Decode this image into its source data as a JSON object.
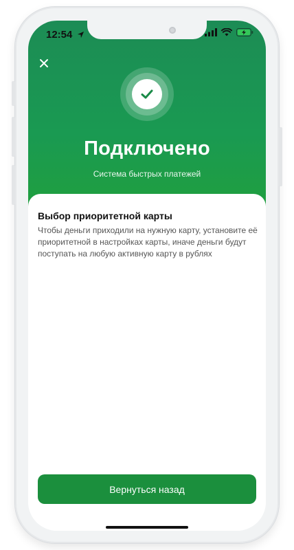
{
  "status_bar": {
    "time": "12:54"
  },
  "header": {
    "title": "Подключено",
    "subtitle": "Система быстрых платежей"
  },
  "card": {
    "title": "Выбор приоритетной карты",
    "text": "Чтобы деньги приходили на нужную карту, установите её приоритетной в настройках карты, иначе деньги будут поступать на любую активную карту в рублях"
  },
  "actions": {
    "back_label": "Вернуться назад"
  },
  "icons": {
    "close": "close-icon",
    "check": "check-icon",
    "location": "location-arrow-icon",
    "signal": "signal-icon",
    "wifi": "wifi-icon",
    "battery": "battery-charging-icon"
  },
  "colors": {
    "brand_green": "#1b8f3d",
    "header_green": "#1c8c55"
  }
}
